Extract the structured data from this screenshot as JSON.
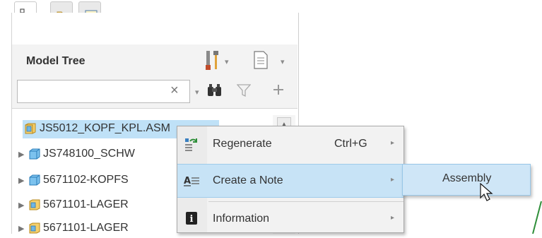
{
  "colors": {
    "selection": "#bfe1f7",
    "menu_highlight": "#c7e3f6",
    "menu_bg": "#f2f2f2",
    "part_icon": "#3aa0d8",
    "assembly_icon": "#e8b43a"
  },
  "tabs": [
    {
      "icon": "model-tree-icon",
      "active": true
    },
    {
      "icon": "folder-browser-icon",
      "active": false
    },
    {
      "icon": "favorites-icon",
      "active": false
    }
  ],
  "model_tree": {
    "title": "Model Tree",
    "search_value": "",
    "search_placeholder": "",
    "clear_glyph": "×",
    "caret_glyph": "▾",
    "tools": [
      "settings-icon",
      "show-icon",
      "find-icon",
      "filter-icon",
      "add-icon"
    ]
  },
  "tree": {
    "root": {
      "label": "JS5012_KOPF_KPL.ASM",
      "icon": "assembly-icon"
    },
    "children": [
      {
        "label": "JS748100_SCHW",
        "icon": "part-icon"
      },
      {
        "label": "5671102-KOPFS",
        "icon": "part-icon"
      },
      {
        "label": "5671101-LAGER",
        "icon": "assembly-icon"
      },
      {
        "label": "5671101-LAGER",
        "icon": "assembly-icon"
      }
    ],
    "expand_glyph": "▶"
  },
  "context_menu": {
    "items": [
      {
        "label": "Regenerate",
        "shortcut": "Ctrl+G",
        "icon": "regenerate-icon",
        "submenu": true
      },
      {
        "label": "Create a Note",
        "shortcut": "",
        "icon": "note-icon",
        "submenu": true
      },
      {
        "label": "Information",
        "shortcut": "",
        "icon": "info-icon",
        "submenu": true
      }
    ],
    "submenu_glyph": "▸"
  },
  "submenu": {
    "label": "Assembly"
  }
}
